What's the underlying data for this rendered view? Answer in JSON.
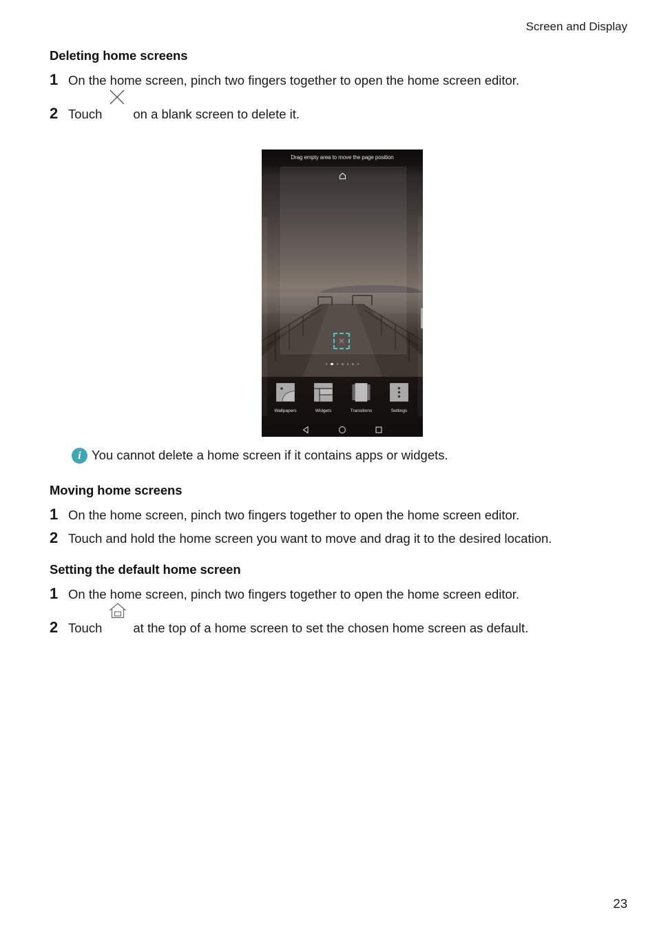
{
  "header": {
    "running_title": "Screen and Display"
  },
  "sections": [
    {
      "heading": "Deleting home screens",
      "steps": [
        {
          "number": "1",
          "text": "On the home screen, pinch two fingers together to open the home screen editor."
        },
        {
          "number": "2",
          "text_before": "Touch",
          "icon": "close-x-icon",
          "text_after": "on a blank screen to delete it."
        }
      ]
    },
    {
      "heading": "Moving home screens",
      "steps": [
        {
          "number": "1",
          "text": "On the home screen, pinch two fingers together to open the home screen editor."
        },
        {
          "number": "2",
          "text": "Touch and hold the home screen you want to move and drag it to the desired location."
        }
      ]
    },
    {
      "heading": "Setting the default home screen",
      "steps": [
        {
          "number": "1",
          "text": "On the home screen, pinch two fingers together to open the home screen editor."
        },
        {
          "number": "2",
          "text_before": "Touch",
          "icon": "home-icon",
          "text_after": "at the top of a home screen to set the chosen home screen as default."
        }
      ]
    }
  ],
  "phone_screenshot": {
    "hint": "Drag empty area to move the page position",
    "page_dots": {
      "count": 7,
      "active_index": 1
    },
    "delete_box_color": "#52c3c9",
    "menu": [
      {
        "label": "Wallpapers",
        "icon": "wallpapers-icon"
      },
      {
        "label": "Widgets",
        "icon": "widgets-icon"
      },
      {
        "label": "Transitions",
        "icon": "transitions-icon"
      },
      {
        "label": "Settings",
        "icon": "settings-icon"
      }
    ],
    "navbar": [
      "back-icon",
      "home-nav-icon",
      "recents-icon"
    ]
  },
  "note": {
    "icon": "info-icon",
    "icon_color": "#3fa6b5",
    "text": "You cannot delete a home screen if it contains apps or widgets."
  },
  "footer": {
    "page_number": "23"
  }
}
